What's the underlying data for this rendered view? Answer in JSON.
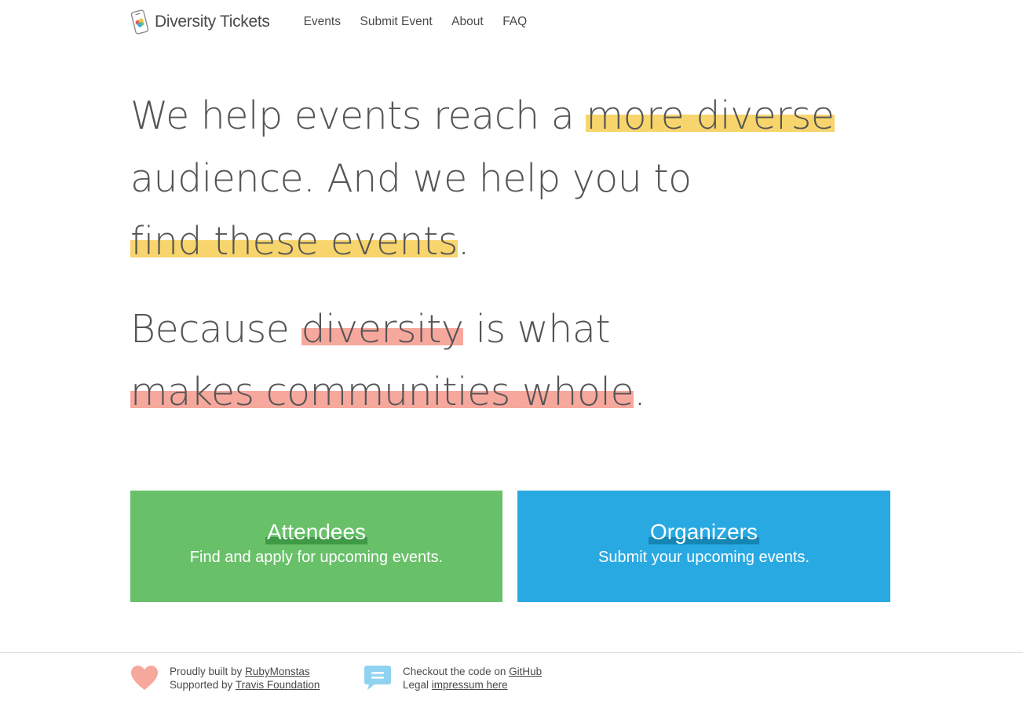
{
  "header": {
    "logo_text": "Diversity Tickets",
    "nav": [
      {
        "label": "Events"
      },
      {
        "label": "Submit Event"
      },
      {
        "label": "About"
      },
      {
        "label": "FAQ"
      }
    ]
  },
  "hero": {
    "line1_a": "We help events reach a ",
    "line1_hl": "more diverse",
    "line2": "audience. And we help you to",
    "line3_hl": "find these events",
    "line3_end": ".",
    "p2_a": "Because ",
    "p2_hl1": "diversity",
    "p2_b": " is what",
    "p2_hl2": "makes communities whole",
    "p2_end": "."
  },
  "cards": {
    "attendees": {
      "title": "Attendees",
      "subtitle": "Find and apply for upcoming events.",
      "color": "#68c069"
    },
    "organizers": {
      "title": "Organizers",
      "subtitle": "Submit your upcoming events.",
      "color": "#29a9e1"
    }
  },
  "footer": {
    "col1": {
      "built_prefix": "Proudly built by ",
      "built_link": "RubyMonstas",
      "supported_prefix": "Supported by ",
      "supported_link": "Travis Foundation",
      "icon": "heart-icon"
    },
    "col2": {
      "code_prefix": "Checkout the code on ",
      "code_link": "GitHub",
      "legal_prefix": "Legal ",
      "legal_link": "impressum here",
      "icon": "chat-bubble-icon"
    }
  },
  "colors": {
    "highlight_yellow": "#f8d56c",
    "highlight_red": "#f7a89d",
    "heart": "#f7a89d",
    "chat": "#8fd3f0"
  }
}
